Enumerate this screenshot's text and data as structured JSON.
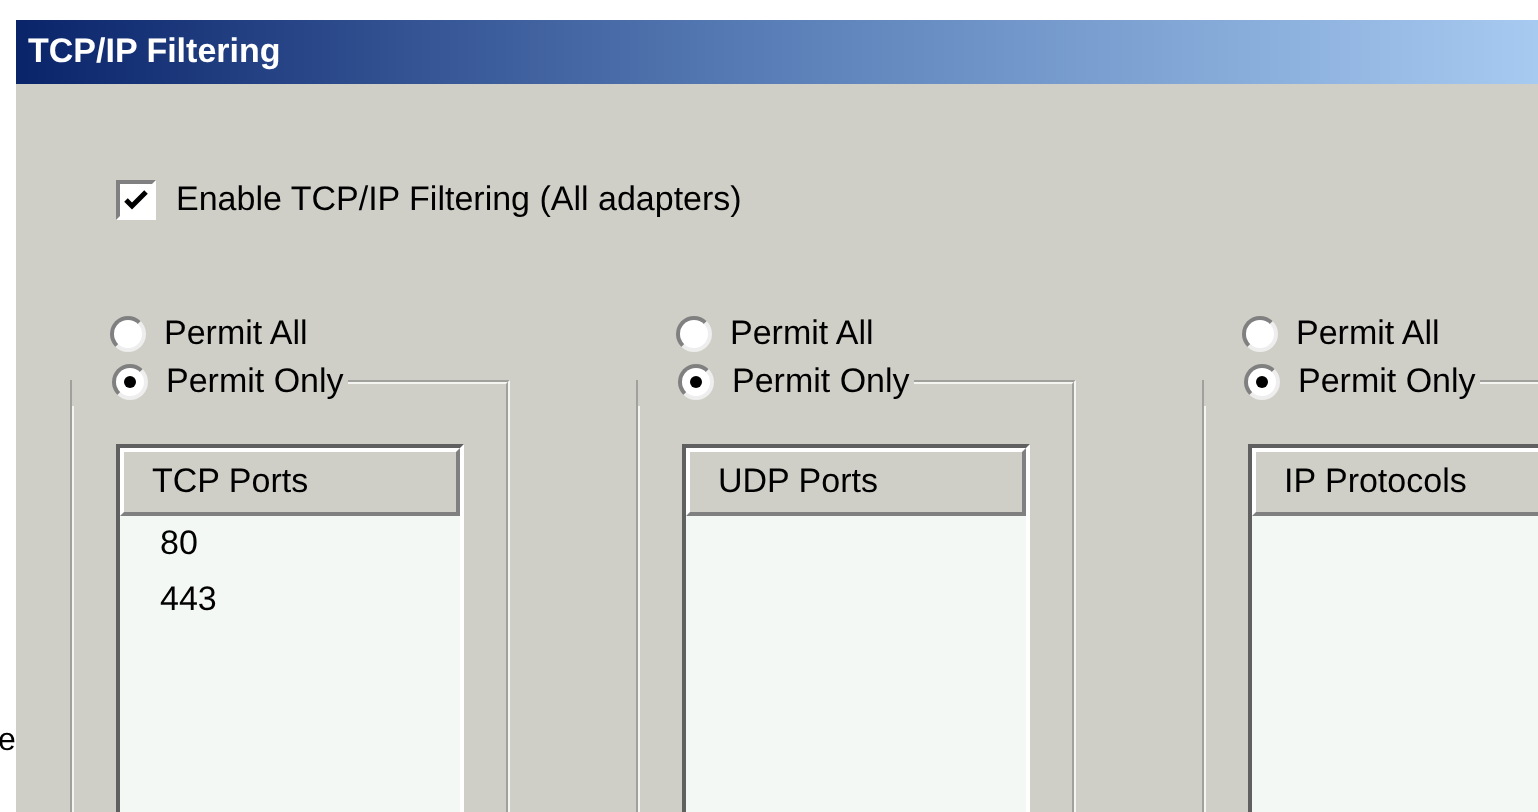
{
  "window": {
    "title": "TCP/IP Filtering"
  },
  "enable": {
    "label": "Enable TCP/IP Filtering (All adapters)",
    "checked": true
  },
  "groups": [
    {
      "options": [
        {
          "label": "Permit All",
          "selected": false
        },
        {
          "label": "Permit Only",
          "selected": true
        }
      ],
      "list": {
        "header": "TCP Ports",
        "items": [
          "80",
          "443"
        ]
      }
    },
    {
      "options": [
        {
          "label": "Permit All",
          "selected": false
        },
        {
          "label": "Permit Only",
          "selected": true
        }
      ],
      "list": {
        "header": "UDP Ports"
      }
    },
    {
      "options": [
        {
          "label": "Permit All",
          "selected": false
        },
        {
          "label": "Permit Only",
          "selected": true
        }
      ],
      "list": {
        "header": "IP Protocols"
      }
    }
  ],
  "background_text": "e"
}
